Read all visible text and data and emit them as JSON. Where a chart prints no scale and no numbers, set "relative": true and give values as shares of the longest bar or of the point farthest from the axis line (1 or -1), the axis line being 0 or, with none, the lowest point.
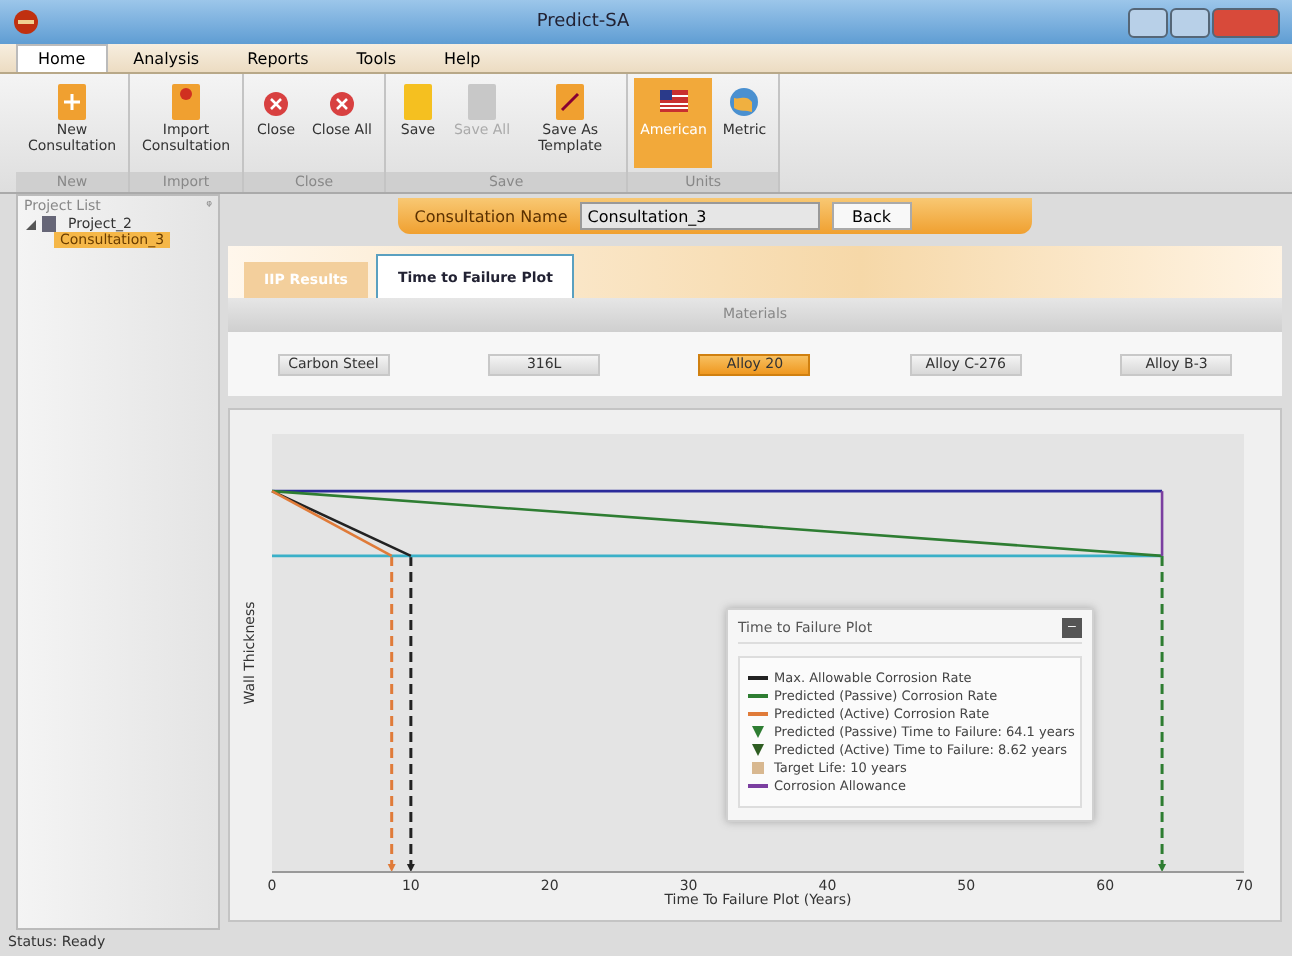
{
  "window": {
    "title": "Predict-SA"
  },
  "menu_tabs": [
    {
      "label": "Home",
      "selected": true
    },
    {
      "label": "Analysis",
      "selected": false
    },
    {
      "label": "Reports",
      "selected": false
    },
    {
      "label": "Tools",
      "selected": false
    },
    {
      "label": "Help",
      "selected": false
    }
  ],
  "ribbon_groups": [
    {
      "label": "New",
      "buttons": [
        {
          "label": "New Consultation",
          "disabled": false,
          "selected": false
        }
      ]
    },
    {
      "label": "Import",
      "buttons": [
        {
          "label": "Import Consultation",
          "disabled": false,
          "selected": false
        }
      ]
    },
    {
      "label": "Close",
      "buttons": [
        {
          "label": "Close",
          "disabled": false,
          "selected": false
        },
        {
          "label": "Close All",
          "disabled": false,
          "selected": false
        }
      ]
    },
    {
      "label": "Save",
      "buttons": [
        {
          "label": "Save",
          "disabled": false,
          "selected": false
        },
        {
          "label": "Save All",
          "disabled": true,
          "selected": false
        },
        {
          "label": "Save As Template",
          "disabled": false,
          "selected": false
        }
      ]
    },
    {
      "label": "Units",
      "buttons": [
        {
          "label": "American",
          "disabled": false,
          "selected": true
        },
        {
          "label": "Metric",
          "disabled": false,
          "selected": false
        }
      ]
    }
  ],
  "project_list": {
    "title": "Project List",
    "pin": "ᵠ",
    "tree": [
      {
        "label": "Project_2",
        "expanded": true,
        "selected": false,
        "children": [
          {
            "label": "Consultation_3",
            "selected": true
          }
        ]
      }
    ]
  },
  "consultation": {
    "label": "Consultation Name",
    "value": "Consultation_3",
    "back": "Back"
  },
  "tabs": [
    {
      "label": "IIP Results",
      "selected": false
    },
    {
      "label": "Time to Failure Plot",
      "selected": true
    }
  ],
  "materials": {
    "title": "Materials",
    "items": [
      {
        "label": "Carbon Steel",
        "selected": false
      },
      {
        "label": "316L",
        "selected": false
      },
      {
        "label": "Alloy 20",
        "selected": true
      },
      {
        "label": "Alloy C-276",
        "selected": false
      },
      {
        "label": "Alloy B-3",
        "selected": false
      }
    ]
  },
  "chart_data": {
    "type": "line",
    "relative": true,
    "xlabel": "Time To Failure Plot (Years)",
    "ylabel": "Wall Thickness",
    "xlim": [
      0,
      70
    ],
    "ylim": [
      0,
      1.15
    ],
    "xticks": [
      0,
      10,
      20,
      30,
      40,
      50,
      60,
      70
    ],
    "series": [
      {
        "color": "#2a2a9a",
        "x": [
          0,
          64.1
        ],
        "values": [
          1,
          1
        ]
      },
      {
        "color": "#3ab0c8",
        "x": [
          0,
          64.1
        ],
        "values": [
          0.83,
          0.83
        ]
      },
      {
        "color": "#222222",
        "x": [
          0,
          10
        ],
        "values": [
          1,
          0.83
        ]
      },
      {
        "color": "#2e7d32",
        "x": [
          0,
          64.1
        ],
        "values": [
          1,
          0.83
        ]
      },
      {
        "color": "#e07b39",
        "x": [
          0,
          8.62
        ],
        "values": [
          1,
          0.83
        ]
      },
      {
        "color": "#7b3fa0",
        "x": [
          64.1,
          64.1
        ],
        "values": [
          1,
          0.83
        ]
      }
    ]
  },
  "legend": {
    "title": "Time to Failure Plot",
    "minimize": "–",
    "items": [
      {
        "kind": "line",
        "color": "#222222",
        "label": "Max. Allowable Corrosion Rate"
      },
      {
        "kind": "line",
        "color": "#2e7d32",
        "label": "Predicted (Passive) Corrosion Rate"
      },
      {
        "kind": "line",
        "color": "#e07b39",
        "label": "Predicted (Active) Corrosion Rate"
      },
      {
        "kind": "triangle",
        "color": "#2e7d32",
        "label": "Predicted (Passive) Time to Failure: 64.1 years"
      },
      {
        "kind": "triangle",
        "color": "#2e5d22",
        "label": "Predicted (Active) Time to Failure: 8.62 years"
      },
      {
        "kind": "square",
        "color": "#d8b890",
        "label": "Target Life: 10 years"
      },
      {
        "kind": "line",
        "color": "#7b3fa0",
        "label": "Corrosion Allowance"
      }
    ]
  },
  "status_bar": "Status: Ready"
}
